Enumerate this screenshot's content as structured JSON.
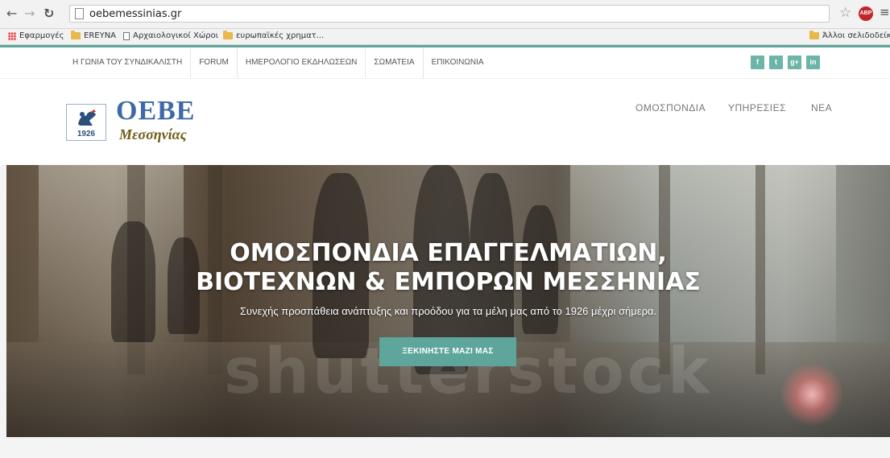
{
  "browser": {
    "url": "oebemessinias.gr",
    "bookmarks": {
      "apps": "Εφαρμογές",
      "items": [
        "EREYNA",
        "Αρχαιολογικοί Χώροι",
        "ευρωπαϊκές χρηματ..."
      ],
      "other": "Άλλοι σελιδοδείκτες"
    }
  },
  "topnav": {
    "items": [
      "Η ΓΩΝΙΑ ΤΟΥ ΣΥΝΔΙΚΑΛΙΣΤΗ",
      "FORUM",
      "ΗΜΕΡΟΛΟΓΙΟ ΕΚΔΗΛΩΣΕΩΝ",
      "ΣΩΜΑΤΕΙΑ",
      "ΕΠΙΚΟΙΝΩΝΙΑ"
    ],
    "social": [
      "f",
      "t",
      "g+",
      "in"
    ]
  },
  "logo": {
    "title": "ΟΕΒΕ",
    "subtitle": "Μεσσηνίας",
    "year": "1926"
  },
  "mainnav": {
    "items": [
      "ΟΜΟΣΠΟΝΔΙΑ",
      "ΥΠΗΡΕΣΙΕΣ",
      "ΝΕΑ"
    ]
  },
  "hero": {
    "title_line1": "ΟΜΟΣΠΟΝΔΙΑ ΕΠΑΓΓΕΛΜΑΤΙΩΝ,",
    "title_line2": "ΒΙΟΤΕΧΝΩΝ & ΕΜΠΟΡΩΝ ΜΕΣΣΗΝΙΑΣ",
    "subtitle": "Συνεχής προσπάθεια ανάπτυξης και προόδου για τα μέλη μας από το 1926 μέχρι σήμερα.",
    "button": "ΞΕΚΙΝΗΣΤΕ ΜΑΖΙ ΜΑΣ",
    "watermark": "shutterstock"
  },
  "colors": {
    "accent": "#5ea69b",
    "logo_blue": "#3d6aa7",
    "logo_gold": "#6b5b17"
  }
}
